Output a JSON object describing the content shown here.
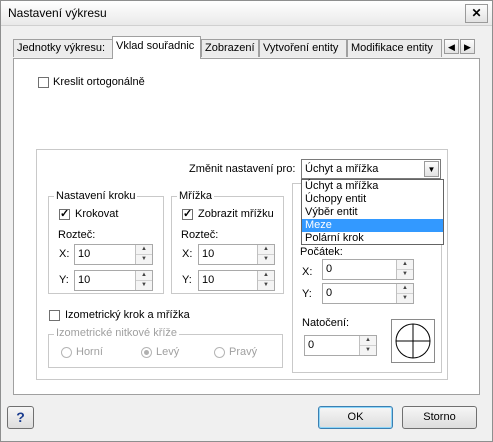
{
  "window": {
    "title": "Nastavení výkresu",
    "close_icon": "close-icon"
  },
  "tabs": [
    {
      "label": "Jednotky výkresu:"
    },
    {
      "label": "Vklad souřadnic",
      "active": true
    },
    {
      "label": "Zobrazení"
    },
    {
      "label": "Vytvoření entity"
    },
    {
      "label": "Modifikace entity"
    }
  ],
  "tab_scroll": {
    "left_icon": "◀",
    "right_icon": "▶"
  },
  "ortho": {
    "label": "Kreslit ortogonálně",
    "checked": false
  },
  "change_settings": {
    "label": "Změnit nastavení pro:",
    "selected": "Úchyt a mřížka",
    "options": [
      "Úchyt a mřížka",
      "Úchopy entit",
      "Výběr entit",
      "Meze",
      "Polární krok"
    ],
    "highlighted": "Meze"
  },
  "step": {
    "title": "Nastavení kroku",
    "checkbox_label": "Krokovat",
    "checked": true,
    "spacing_label": "Rozteč:",
    "x_label": "X:",
    "x_value": "10",
    "y_label": "Y:",
    "y_value": "10"
  },
  "grid": {
    "title": "Mřížka",
    "checkbox_label": "Zobrazit mřížku",
    "checked": true,
    "spacing_label": "Rozteč:",
    "x_label": "X:",
    "x_value": "10",
    "y_label": "Y:",
    "y_value": "10"
  },
  "origin": {
    "title": "Počátek:",
    "x_label": "X:",
    "x_value": "0",
    "y_label": "Y:",
    "y_value": "0"
  },
  "rotation": {
    "label": "Natočení:",
    "value": "0"
  },
  "iso": {
    "checkbox_label": "Izometrický krok a mřížka",
    "checked": false,
    "crosshair_title": "Izometrické nitkové kříže",
    "options": [
      "Horní",
      "Levý",
      "Pravý"
    ],
    "selected": "Levý"
  },
  "buttons": {
    "ok": "OK",
    "cancel": "Storno",
    "help": "?"
  }
}
